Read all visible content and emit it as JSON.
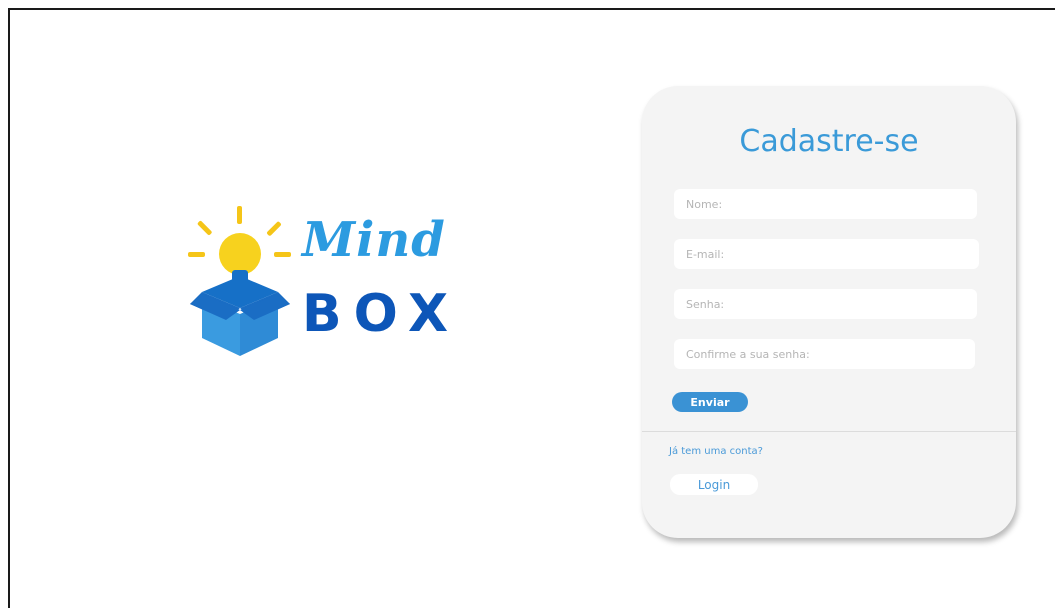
{
  "logo": {
    "word_top": "Mind",
    "word_bottom": "BOX",
    "colors": {
      "mind": "#2c9be0",
      "box": "#0d56b8",
      "bulb": "#f7d21e",
      "ray": "#f5c518",
      "box_light": "#3a9be0",
      "box_dark": "#1670c7"
    }
  },
  "signup": {
    "title": "Cadastre-se",
    "fields": {
      "name_placeholder": "Nome:",
      "email_placeholder": "E-mail:",
      "password_placeholder": "Senha:",
      "confirm_placeholder": "Confirme a sua senha:"
    },
    "submit_label": "Enviar",
    "have_account_text": "Já tem uma conta?",
    "login_label": "Login",
    "accent_color": "#3a92d4"
  }
}
